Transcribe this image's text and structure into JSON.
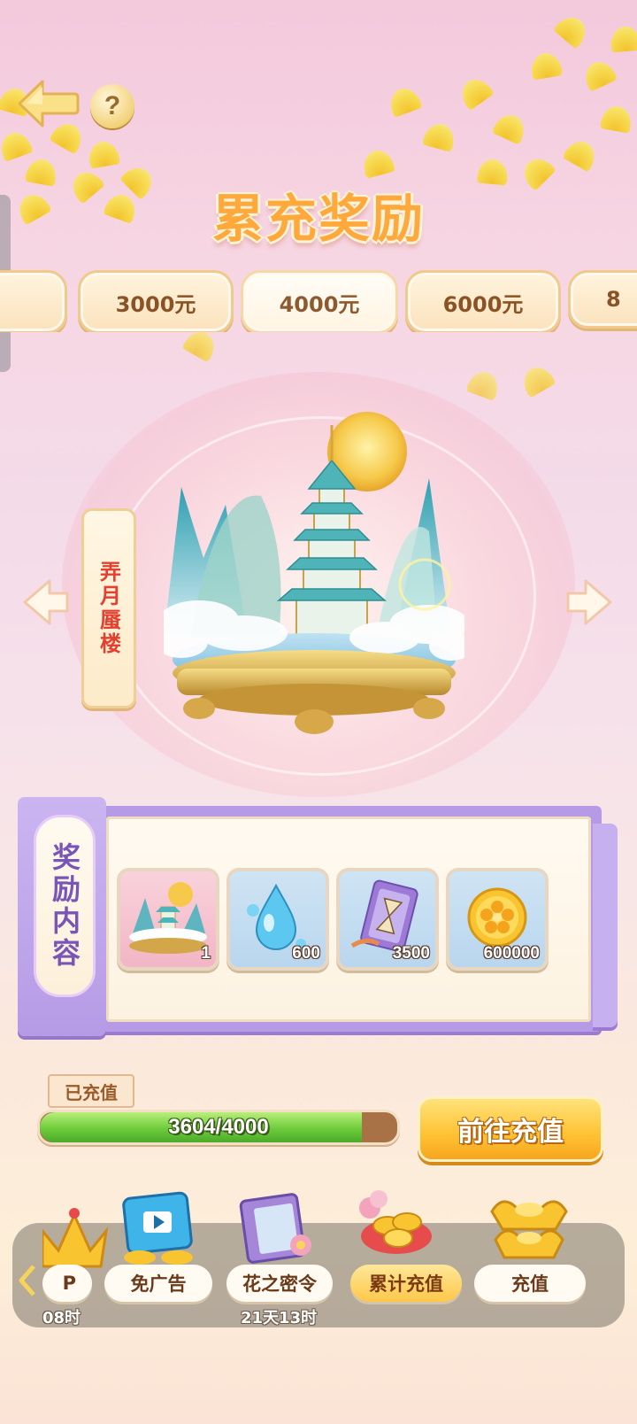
{
  "header": {
    "title": "累充奖励",
    "help_label": "?"
  },
  "tiers": [
    {
      "label": "3000元",
      "active": false
    },
    {
      "label": "4000元",
      "active": true
    },
    {
      "label": "6000元",
      "active": false
    },
    {
      "label": "8",
      "active": false
    }
  ],
  "showcase": {
    "item_name": "弄月蜃楼"
  },
  "rewards_panel": {
    "label": "奖励内容",
    "items": [
      {
        "name": "diorama-reward",
        "qty": "1"
      },
      {
        "name": "water-drop",
        "qty": "600"
      },
      {
        "name": "hourglass-card",
        "qty": "3500"
      },
      {
        "name": "flower-coin",
        "qty": "600000"
      }
    ]
  },
  "progress": {
    "tag": "已充值",
    "current": 3604,
    "target": 4000,
    "text": "3604/4000",
    "button_label": "前往充值"
  },
  "bottom_nav": {
    "items": [
      {
        "label": "P",
        "timer": "08时"
      },
      {
        "label": "免广告",
        "timer": ""
      },
      {
        "label": "花之密令",
        "timer": "21天13时"
      },
      {
        "label": "累计充值",
        "timer": "",
        "active": true
      },
      {
        "label": "充值",
        "timer": ""
      }
    ]
  },
  "colors": {
    "title": "#ffa93d",
    "progress_fill": "#6dcb3a",
    "button": "#ffc233",
    "panel_purple": "#b79ae6"
  }
}
